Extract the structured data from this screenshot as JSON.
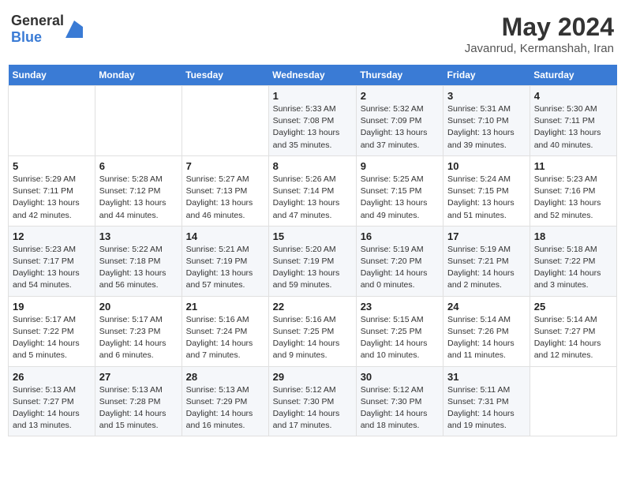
{
  "header": {
    "logo_general": "General",
    "logo_blue": "Blue",
    "month_year": "May 2024",
    "location": "Javanrud, Kermanshah, Iran"
  },
  "days_of_week": [
    "Sunday",
    "Monday",
    "Tuesday",
    "Wednesday",
    "Thursday",
    "Friday",
    "Saturday"
  ],
  "weeks": [
    [
      {
        "day": "",
        "sunrise": "",
        "sunset": "",
        "daylight": ""
      },
      {
        "day": "",
        "sunrise": "",
        "sunset": "",
        "daylight": ""
      },
      {
        "day": "",
        "sunrise": "",
        "sunset": "",
        "daylight": ""
      },
      {
        "day": "1",
        "sunrise": "Sunrise: 5:33 AM",
        "sunset": "Sunset: 7:08 PM",
        "daylight": "Daylight: 13 hours and 35 minutes."
      },
      {
        "day": "2",
        "sunrise": "Sunrise: 5:32 AM",
        "sunset": "Sunset: 7:09 PM",
        "daylight": "Daylight: 13 hours and 37 minutes."
      },
      {
        "day": "3",
        "sunrise": "Sunrise: 5:31 AM",
        "sunset": "Sunset: 7:10 PM",
        "daylight": "Daylight: 13 hours and 39 minutes."
      },
      {
        "day": "4",
        "sunrise": "Sunrise: 5:30 AM",
        "sunset": "Sunset: 7:11 PM",
        "daylight": "Daylight: 13 hours and 40 minutes."
      }
    ],
    [
      {
        "day": "5",
        "sunrise": "Sunrise: 5:29 AM",
        "sunset": "Sunset: 7:11 PM",
        "daylight": "Daylight: 13 hours and 42 minutes."
      },
      {
        "day": "6",
        "sunrise": "Sunrise: 5:28 AM",
        "sunset": "Sunset: 7:12 PM",
        "daylight": "Daylight: 13 hours and 44 minutes."
      },
      {
        "day": "7",
        "sunrise": "Sunrise: 5:27 AM",
        "sunset": "Sunset: 7:13 PM",
        "daylight": "Daylight: 13 hours and 46 minutes."
      },
      {
        "day": "8",
        "sunrise": "Sunrise: 5:26 AM",
        "sunset": "Sunset: 7:14 PM",
        "daylight": "Daylight: 13 hours and 47 minutes."
      },
      {
        "day": "9",
        "sunrise": "Sunrise: 5:25 AM",
        "sunset": "Sunset: 7:15 PM",
        "daylight": "Daylight: 13 hours and 49 minutes."
      },
      {
        "day": "10",
        "sunrise": "Sunrise: 5:24 AM",
        "sunset": "Sunset: 7:15 PM",
        "daylight": "Daylight: 13 hours and 51 minutes."
      },
      {
        "day": "11",
        "sunrise": "Sunrise: 5:23 AM",
        "sunset": "Sunset: 7:16 PM",
        "daylight": "Daylight: 13 hours and 52 minutes."
      }
    ],
    [
      {
        "day": "12",
        "sunrise": "Sunrise: 5:23 AM",
        "sunset": "Sunset: 7:17 PM",
        "daylight": "Daylight: 13 hours and 54 minutes."
      },
      {
        "day": "13",
        "sunrise": "Sunrise: 5:22 AM",
        "sunset": "Sunset: 7:18 PM",
        "daylight": "Daylight: 13 hours and 56 minutes."
      },
      {
        "day": "14",
        "sunrise": "Sunrise: 5:21 AM",
        "sunset": "Sunset: 7:19 PM",
        "daylight": "Daylight: 13 hours and 57 minutes."
      },
      {
        "day": "15",
        "sunrise": "Sunrise: 5:20 AM",
        "sunset": "Sunset: 7:19 PM",
        "daylight": "Daylight: 13 hours and 59 minutes."
      },
      {
        "day": "16",
        "sunrise": "Sunrise: 5:19 AM",
        "sunset": "Sunset: 7:20 PM",
        "daylight": "Daylight: 14 hours and 0 minutes."
      },
      {
        "day": "17",
        "sunrise": "Sunrise: 5:19 AM",
        "sunset": "Sunset: 7:21 PM",
        "daylight": "Daylight: 14 hours and 2 minutes."
      },
      {
        "day": "18",
        "sunrise": "Sunrise: 5:18 AM",
        "sunset": "Sunset: 7:22 PM",
        "daylight": "Daylight: 14 hours and 3 minutes."
      }
    ],
    [
      {
        "day": "19",
        "sunrise": "Sunrise: 5:17 AM",
        "sunset": "Sunset: 7:22 PM",
        "daylight": "Daylight: 14 hours and 5 minutes."
      },
      {
        "day": "20",
        "sunrise": "Sunrise: 5:17 AM",
        "sunset": "Sunset: 7:23 PM",
        "daylight": "Daylight: 14 hours and 6 minutes."
      },
      {
        "day": "21",
        "sunrise": "Sunrise: 5:16 AM",
        "sunset": "Sunset: 7:24 PM",
        "daylight": "Daylight: 14 hours and 7 minutes."
      },
      {
        "day": "22",
        "sunrise": "Sunrise: 5:16 AM",
        "sunset": "Sunset: 7:25 PM",
        "daylight": "Daylight: 14 hours and 9 minutes."
      },
      {
        "day": "23",
        "sunrise": "Sunrise: 5:15 AM",
        "sunset": "Sunset: 7:25 PM",
        "daylight": "Daylight: 14 hours and 10 minutes."
      },
      {
        "day": "24",
        "sunrise": "Sunrise: 5:14 AM",
        "sunset": "Sunset: 7:26 PM",
        "daylight": "Daylight: 14 hours and 11 minutes."
      },
      {
        "day": "25",
        "sunrise": "Sunrise: 5:14 AM",
        "sunset": "Sunset: 7:27 PM",
        "daylight": "Daylight: 14 hours and 12 minutes."
      }
    ],
    [
      {
        "day": "26",
        "sunrise": "Sunrise: 5:13 AM",
        "sunset": "Sunset: 7:27 PM",
        "daylight": "Daylight: 14 hours and 13 minutes."
      },
      {
        "day": "27",
        "sunrise": "Sunrise: 5:13 AM",
        "sunset": "Sunset: 7:28 PM",
        "daylight": "Daylight: 14 hours and 15 minutes."
      },
      {
        "day": "28",
        "sunrise": "Sunrise: 5:13 AM",
        "sunset": "Sunset: 7:29 PM",
        "daylight": "Daylight: 14 hours and 16 minutes."
      },
      {
        "day": "29",
        "sunrise": "Sunrise: 5:12 AM",
        "sunset": "Sunset: 7:30 PM",
        "daylight": "Daylight: 14 hours and 17 minutes."
      },
      {
        "day": "30",
        "sunrise": "Sunrise: 5:12 AM",
        "sunset": "Sunset: 7:30 PM",
        "daylight": "Daylight: 14 hours and 18 minutes."
      },
      {
        "day": "31",
        "sunrise": "Sunrise: 5:11 AM",
        "sunset": "Sunset: 7:31 PM",
        "daylight": "Daylight: 14 hours and 19 minutes."
      },
      {
        "day": "",
        "sunrise": "",
        "sunset": "",
        "daylight": ""
      }
    ]
  ]
}
